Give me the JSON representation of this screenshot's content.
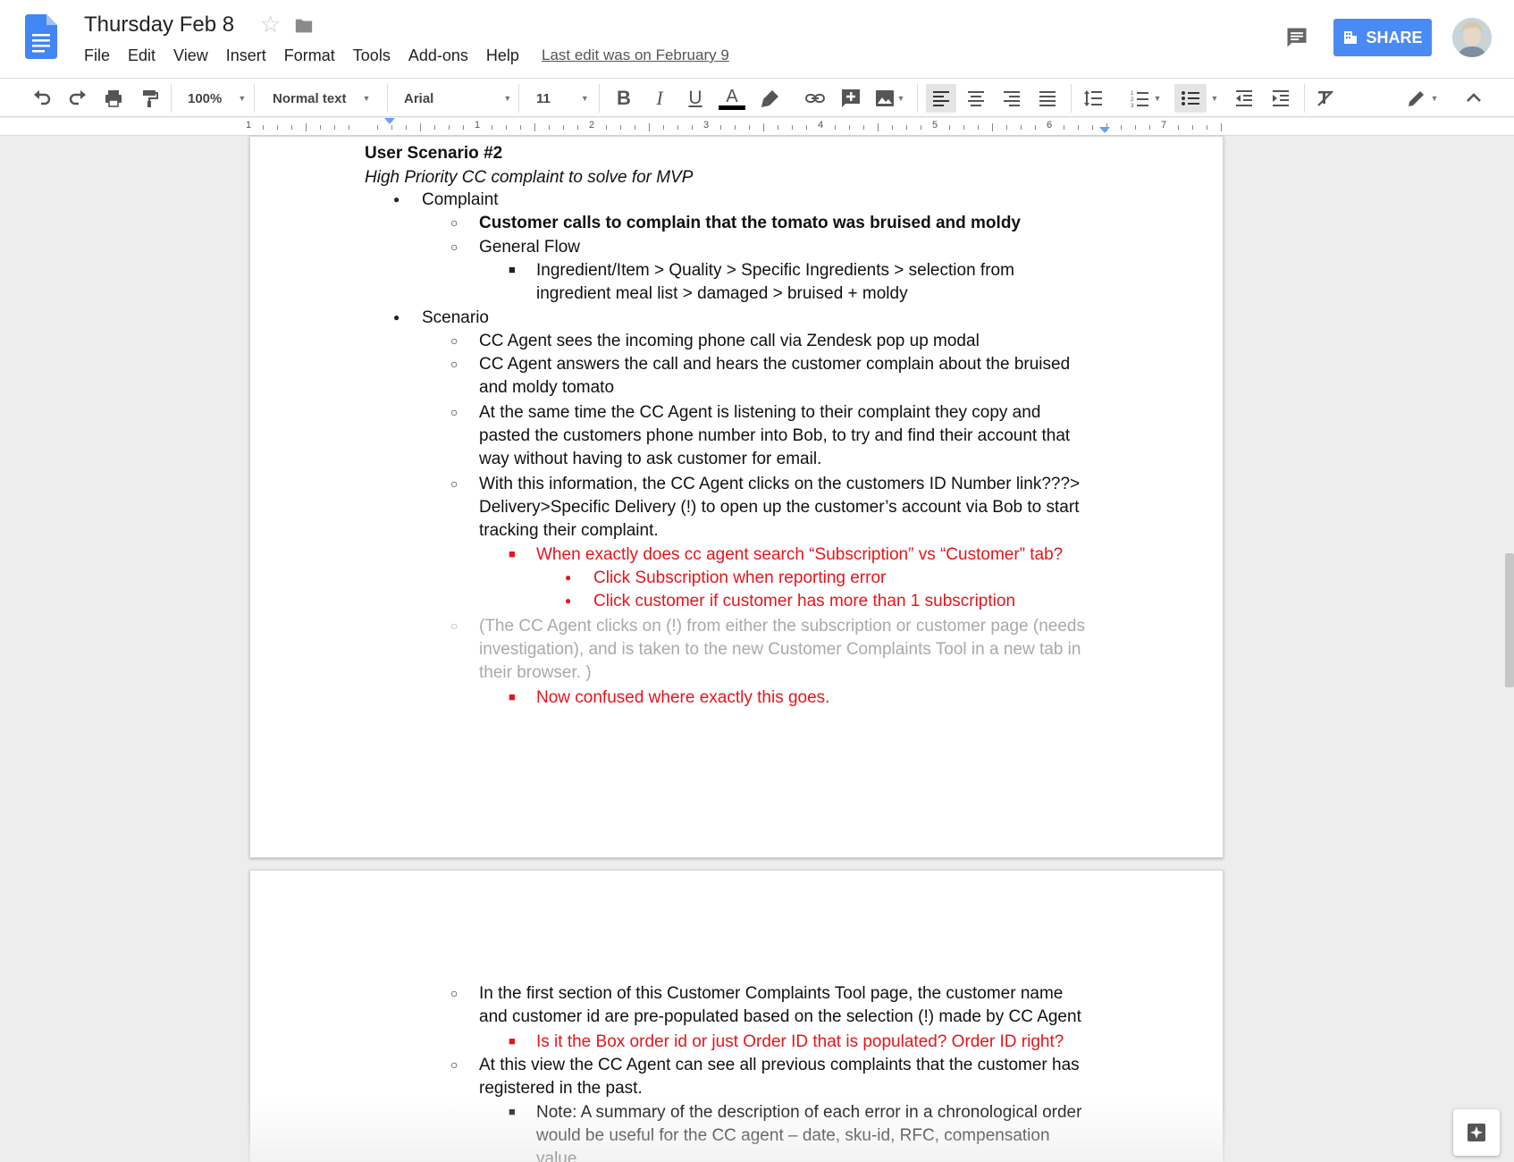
{
  "header": {
    "doc_title": "Thursday Feb 8",
    "last_edit": "Last edit was on February 9",
    "share_label": "SHARE",
    "menus": [
      "File",
      "Edit",
      "View",
      "Insert",
      "Format",
      "Tools",
      "Add-ons",
      "Help"
    ]
  },
  "toolbar": {
    "zoom": "100%",
    "style": "Normal text",
    "font": "Arial",
    "size": "11",
    "icons": [
      "undo-icon",
      "redo-icon",
      "print-icon",
      "paint-format-icon",
      "bold-icon",
      "italic-icon",
      "underline-icon",
      "text-color-icon",
      "highlight-icon",
      "link-icon",
      "comment-add-icon",
      "image-icon",
      "align-left-icon",
      "align-center-icon",
      "align-right-icon",
      "align-justify-icon",
      "line-spacing-icon",
      "numbered-list-icon",
      "bulleted-list-icon",
      "decrease-indent-icon",
      "increase-indent-icon",
      "clear-formatting-icon",
      "editing-mode-icon",
      "collapse-icon"
    ]
  },
  "ruler": {
    "numbers": [
      "1",
      "1",
      "2",
      "3",
      "4",
      "5",
      "6",
      "7"
    ]
  },
  "colors": {
    "accent": "#4a8af4",
    "red_text": "#e8141a",
    "grey_text": "#a9a9a9"
  },
  "page1": {
    "heading": "User Scenario #2",
    "subheading": "High Priority CC complaint to solve for MVP",
    "complaint_label": "Complaint",
    "complaint_bold": "Customer calls to complain that the tomato was bruised and moldy",
    "general_flow": "General Flow",
    "flow_line1": "Ingredient/Item > Quality > Specific Ingredients > selection from",
    "flow_line2": "ingredient meal list > damaged > bruised + moldy",
    "scenario_label": "Scenario",
    "s1": "CC Agent sees the incoming phone call via Zendesk pop up modal",
    "s2_l1": "CC Agent answers the call and hears the customer complain about the bruised",
    "s2_l2": "and moldy tomato",
    "s3_l1": "At the same time the CC Agent is listening to their complaint they copy and",
    "s3_l2": "pasted the customers phone number into Bob, to try and find their account that",
    "s3_l3": "way without having to ask customer for email.",
    "s4_l1": "With this information, the CC Agent clicks on the customers ID Number link???>",
    "s4_l2": "Delivery>Specific Delivery (!) to open up the customer’s account via Bob to start",
    "s4_l3": "tracking their complaint.",
    "q1": "When exactly does cc agent search “Subscription” vs “Customer” tab?",
    "q1_a": "Click Subscription when reporting error",
    "q1_b": "Click customer if customer has more than 1 subscription",
    "g_l1": "(The CC Agent clicks on (!) from either the subscription or customer page (needs",
    "g_l2": "investigation), and is taken to the new Customer Complaints Tool in a new tab in",
    "g_l3": "their browser. )",
    "q2": "Now confused where exactly this goes."
  },
  "page2": {
    "p1_l1": "In the first section of this Customer Complaints Tool page, the customer name",
    "p1_l2": "and customer id are pre-populated based on the selection (!) made by CC Agent",
    "q3": "Is it the Box order id or just Order ID that is populated? Order ID right?",
    "p2_l1": "At this view the CC Agent can see all previous complaints that the customer has",
    "p2_l2": "registered in the past.",
    "n_l1": "Note: A summary of the description of each error in a chronological order",
    "n_l2": "would be useful for the CC agent – date, sku-id, RFC, compensation",
    "n_l3": "value"
  }
}
